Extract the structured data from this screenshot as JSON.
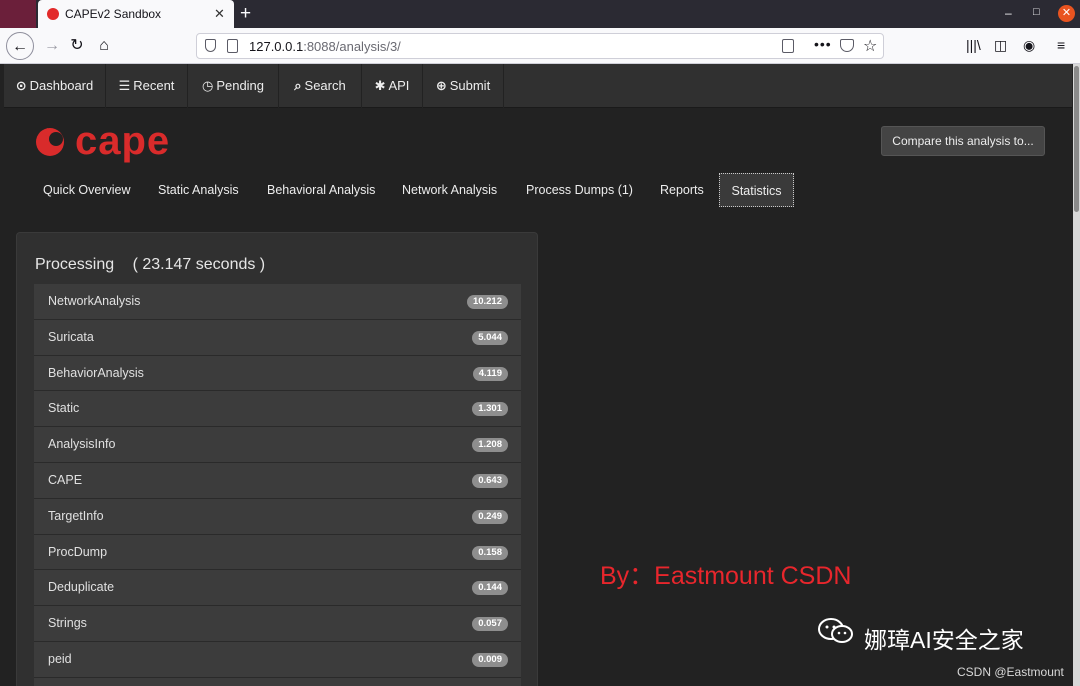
{
  "browser": {
    "tab_title": "CAPEv2 Sandbox",
    "tab_close": "✕",
    "new_tab": "+",
    "url_host": "127.0.0.1",
    "url_rest": ":8088/analysis/3/",
    "window_controls": [
      "–",
      "□"
    ],
    "window_close": "✕"
  },
  "appnav": {
    "items": [
      {
        "icon": "⊙",
        "label": "Dashboard"
      },
      {
        "icon": "☰",
        "label": "Recent"
      },
      {
        "icon": "◷",
        "label": "Pending"
      },
      {
        "icon": "⌕",
        "label": "Search"
      },
      {
        "icon": "✱",
        "label": "API"
      },
      {
        "icon": "⊕",
        "label": "Submit"
      }
    ]
  },
  "brand": {
    "logo_text": "cape",
    "accent": "#d92b2b"
  },
  "compare_button": "Compare this analysis to...",
  "subtabs": [
    "Quick Overview",
    "Static Analysis",
    "Behavioral Analysis",
    "Network Analysis",
    "Process Dumps (1)",
    "Reports",
    "Statistics"
  ],
  "processing": {
    "title": "Processing",
    "total": "( 23.147 seconds )",
    "rows": [
      {
        "name": "NetworkAnalysis",
        "value": "10.212"
      },
      {
        "name": "Suricata",
        "value": "5.044"
      },
      {
        "name": "BehaviorAnalysis",
        "value": "4.119"
      },
      {
        "name": "Static",
        "value": "1.301"
      },
      {
        "name": "AnalysisInfo",
        "value": "1.208"
      },
      {
        "name": "CAPE",
        "value": "0.643"
      },
      {
        "name": "TargetInfo",
        "value": "0.249"
      },
      {
        "name": "ProcDump",
        "value": "0.158"
      },
      {
        "name": "Deduplicate",
        "value": "0.144"
      },
      {
        "name": "Strings",
        "value": "0.057"
      },
      {
        "name": "peid",
        "value": "0.009"
      }
    ]
  },
  "watermark": "By：Eastmount CSDN",
  "wechat_account": "娜璋AI安全之家",
  "csdn_credit": "CSDN @Eastmount"
}
